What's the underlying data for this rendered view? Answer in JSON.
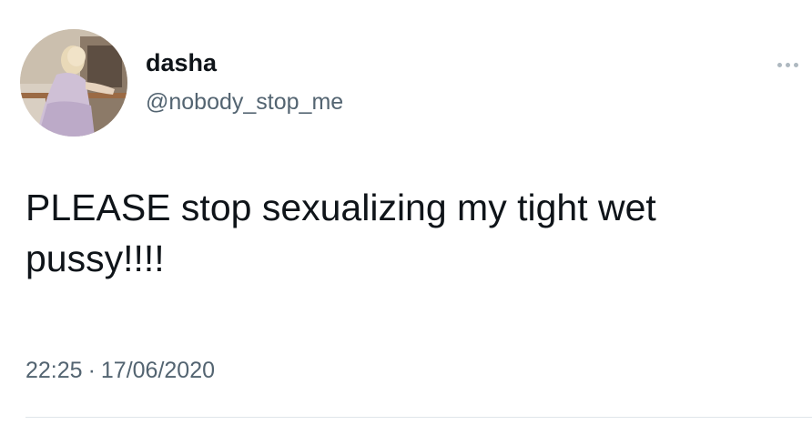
{
  "user": {
    "display_name": "dasha",
    "handle": "@nobody_stop_me",
    "avatar_icon": "profile-photo"
  },
  "tweet": {
    "text": "PLEASE stop sexualizing my tight wet pussy!!!!",
    "time": "22:25",
    "separator": "·",
    "date": "17/06/2020"
  },
  "menu": {
    "icon": "more-dots-icon"
  },
  "colors": {
    "text_primary": "#0f1419",
    "text_secondary": "#536471",
    "background": "#ffffff",
    "divider": "#dfe5ea"
  }
}
